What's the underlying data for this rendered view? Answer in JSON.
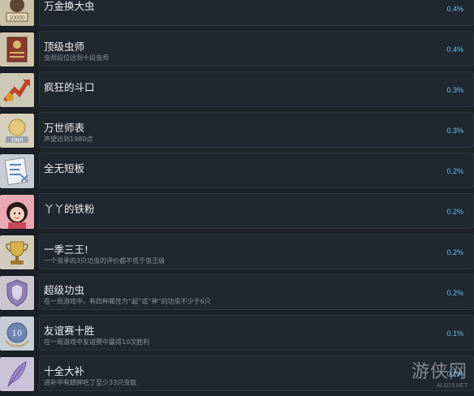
{
  "achievements": [
    {
      "name": "万金换大虫",
      "desc": "",
      "percent": "0.4%",
      "icon": "money-bag-icon"
    },
    {
      "name": "顶级虫师",
      "desc": "虫师段位达到十段虫师",
      "percent": "0.4%",
      "icon": "certificate-book-icon"
    },
    {
      "name": "疯狂的斗口",
      "desc": "",
      "percent": "0.3%",
      "icon": "rising-arrow-icon"
    },
    {
      "name": "万世师表",
      "desc": "声望达到1980点",
      "percent": "0.3%",
      "icon": "medal-1980-icon"
    },
    {
      "name": "全无短板",
      "desc": "",
      "percent": "0.2%",
      "icon": "stats-sheet-icon"
    },
    {
      "name": "丫丫的铁粉",
      "desc": "",
      "percent": "0.2%",
      "icon": "girl-portrait-icon"
    },
    {
      "name": "一季三王!",
      "desc": "一个虫季的3只功虫的评价都不低于虫王级",
      "percent": "0.2%",
      "icon": "trophy-icon"
    },
    {
      "name": "超级功虫",
      "desc": "在一局游戏中，有四种属性为“超”或“神”的功虫不少于6只",
      "percent": "0.2%",
      "icon": "shield-badge-icon"
    },
    {
      "name": "友谊赛十胜",
      "desc": "在一局游戏中友谊赛中赢得10次胜利",
      "percent": "0.1%",
      "icon": "laurel-emblem-icon"
    },
    {
      "name": "十全大补",
      "desc": "进补中有蟋蟀吃了至少33只虫蚁",
      "percent": "0.1%",
      "icon": "feather-icon"
    }
  ],
  "watermark": {
    "text": "游侠网",
    "sub": "ALI213.NET"
  }
}
